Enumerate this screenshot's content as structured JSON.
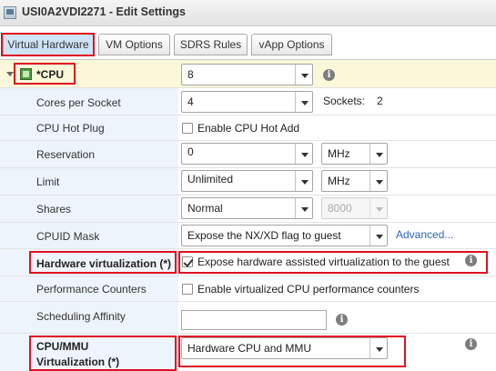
{
  "window": {
    "title": "USI0A2VDI2271 - Edit Settings"
  },
  "tabs": [
    {
      "label": "Virtual Hardware"
    },
    {
      "label": "VM Options"
    },
    {
      "label": "SDRS Rules"
    },
    {
      "label": "vApp Options"
    }
  ],
  "cpu": {
    "label": "*CPU",
    "value": "8",
    "cores_per_socket": {
      "label": "Cores per Socket",
      "value": "4",
      "sockets_label": "Sockets:",
      "sockets_value": "2"
    },
    "hot_plug": {
      "label": "CPU Hot Plug",
      "checkbox_label": "Enable CPU Hot Add",
      "checked": false
    },
    "reservation": {
      "label": "Reservation",
      "value": "0",
      "unit": "MHz"
    },
    "limit": {
      "label": "Limit",
      "value": "Unlimited",
      "unit": "MHz"
    },
    "shares": {
      "label": "Shares",
      "value": "Normal",
      "amount": "8000"
    },
    "cpuid_mask": {
      "label": "CPUID Mask",
      "value": "Expose the NX/XD flag to guest",
      "advanced": "Advanced..."
    },
    "hw_virtualization": {
      "label": "Hardware virtualization (*)",
      "checkbox_label": "Expose hardware assisted virtualization to the guest",
      "checked": true
    },
    "perf_counters": {
      "label": "Performance Counters",
      "checkbox_label": "Enable virtualized CPU performance counters",
      "checked": false
    },
    "sched_affinity": {
      "label": "Scheduling Affinity",
      "value": ""
    },
    "mmu_virtualization": {
      "label_line1": "CPU/MMU",
      "label_line2": "Virtualization (*)",
      "value": "Hardware CPU and MMU"
    }
  },
  "icons": {
    "info": "i",
    "highlight_color": "#e01020",
    "selected_tab_color": "#cfe3f6"
  }
}
